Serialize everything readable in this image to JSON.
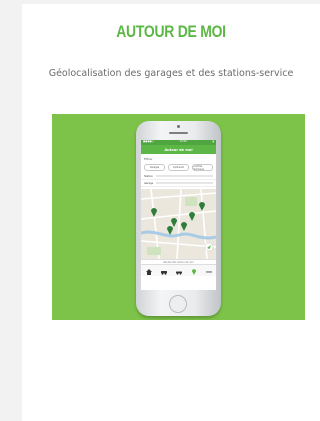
{
  "section": {
    "title": "AUTOUR DE MOI",
    "subtitle": "Géolocalisation des garages et des stations-service"
  },
  "colors": {
    "accent": "#5db746",
    "hero_background": "#7dc349",
    "card_background": "#ffffff",
    "page_background": "#f2f2f2"
  },
  "phone_screen": {
    "status_left": "●●●●○",
    "status_center": "15:00",
    "status_right": "▮",
    "app_title": "Autour de moi",
    "filter_label": "Filtrer",
    "chips": [
      "Garages",
      "Carburant",
      "Contrôle technique"
    ],
    "fields": [
      {
        "label": "Station"
      },
      {
        "label": "Garage"
      }
    ],
    "map_footer": "Rechercher autour de moi",
    "tabs": [
      {
        "icon": "car-icon",
        "label": ""
      },
      {
        "icon": "car-icon",
        "label": ""
      },
      {
        "icon": "car-icon",
        "label": ""
      },
      {
        "icon": "map-pin-icon",
        "label": ""
      },
      {
        "icon": "more-icon",
        "label": ""
      }
    ]
  }
}
